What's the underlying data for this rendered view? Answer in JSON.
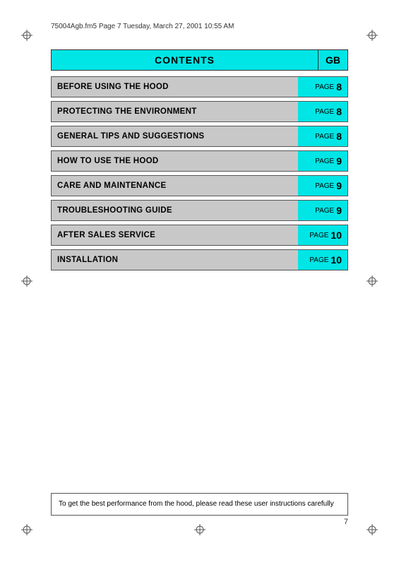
{
  "header": {
    "file_info": "75004Agb.fm5  Page 7  Tuesday, March 27, 2001  10:55 AM"
  },
  "contents": {
    "title": "CONTENTS",
    "gb_label": "GB",
    "rows": [
      {
        "label": "BEFORE USING THE HOOD",
        "page_word": "PAGE",
        "page_num": "8"
      },
      {
        "label": "PROTECTING THE ENVIRONMENT",
        "page_word": "PAGE",
        "page_num": "8"
      },
      {
        "label": "GENERAL TIPS AND SUGGESTIONS",
        "page_word": "PAGE",
        "page_num": "8"
      },
      {
        "label": "HOW TO USE THE HOOD",
        "page_word": "PAGE",
        "page_num": "9"
      },
      {
        "label": "CARE AND MAINTENANCE",
        "page_word": "PAGE",
        "page_num": "9"
      },
      {
        "label": "TROUBLESHOOTING GUIDE",
        "page_word": "PAGE",
        "page_num": "9"
      },
      {
        "label": "AFTER SALES SERVICE",
        "page_word": "PAGE",
        "page_num": "10"
      },
      {
        "label": "INSTALLATION",
        "page_word": "PAGE",
        "page_num": "10"
      }
    ]
  },
  "footer": {
    "note": "To get the best performance from the hood, please read these user instructions carefully"
  },
  "page_number": "7"
}
